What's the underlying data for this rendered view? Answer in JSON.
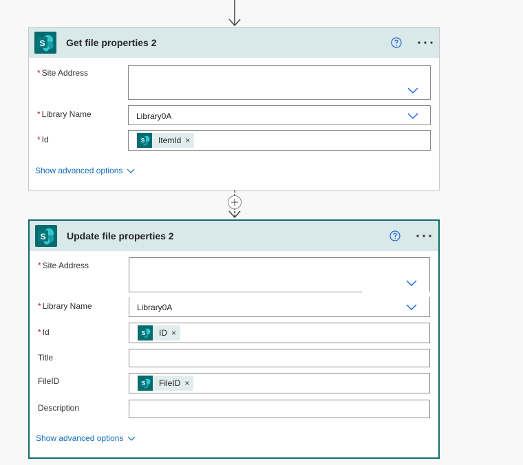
{
  "colors": {
    "accent": "#036c70",
    "header_bg": "#d9e8e8",
    "link": "#0f6cbd",
    "required": "#a4262c"
  },
  "cards": [
    {
      "title": "Get file properties 2",
      "fields": [
        {
          "label": "Site Address",
          "required": true,
          "value": ""
        },
        {
          "label": "Library Name",
          "required": true,
          "value": "Library0A"
        },
        {
          "label": "Id",
          "required": true,
          "token": "ItemId"
        }
      ],
      "advanced_label": "Show advanced options"
    },
    {
      "title": "Update file properties 2",
      "fields": [
        {
          "label": "Site Address",
          "required": true,
          "value": ""
        },
        {
          "label": "Library Name",
          "required": true,
          "value": "Library0A"
        },
        {
          "label": "Id",
          "required": true,
          "token": "ID"
        },
        {
          "label": "Title",
          "required": false,
          "value": ""
        },
        {
          "label": "FileID",
          "required": false,
          "token": "FileID"
        },
        {
          "label": "Description",
          "required": false,
          "value": ""
        }
      ],
      "advanced_label": "Show advanced options"
    }
  ],
  "required_mark": "*",
  "token_remove": "×",
  "logo_letter": "S",
  "icons": [
    "sharepoint-icon",
    "help-icon",
    "more-icon",
    "chevron-down-icon",
    "close-icon",
    "add-step-icon",
    "arrow-down-icon"
  ]
}
